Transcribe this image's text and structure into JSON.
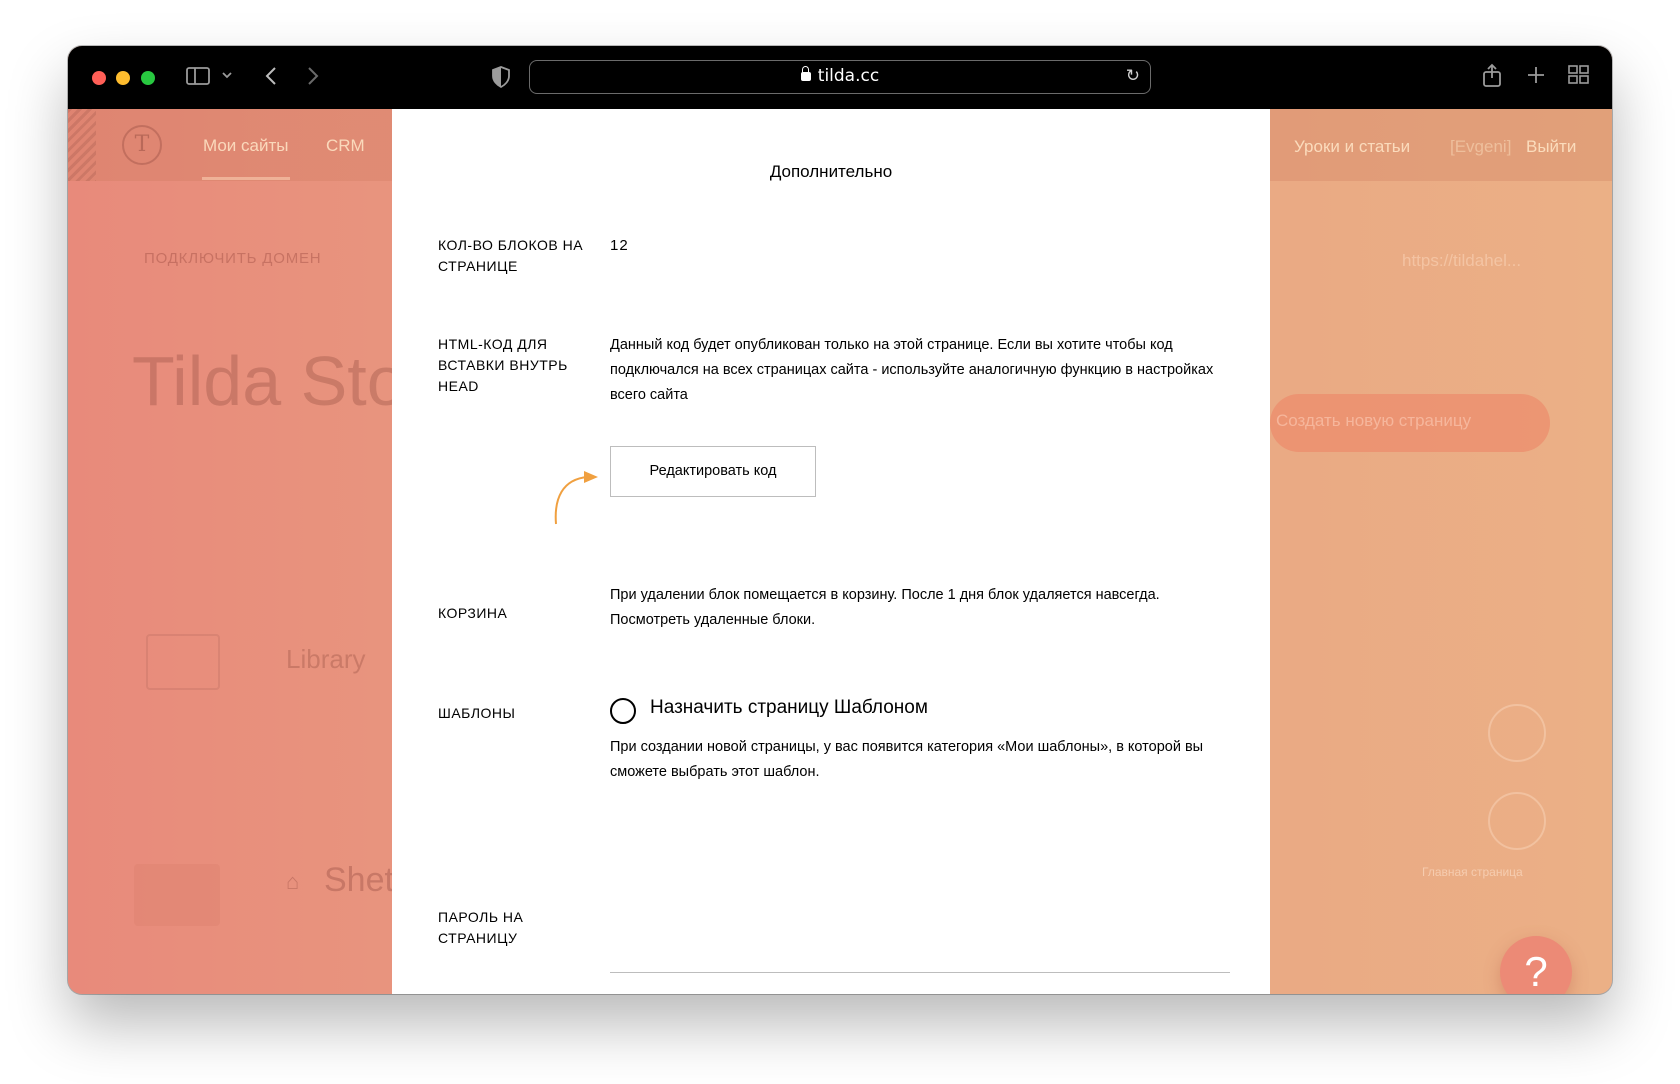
{
  "browser": {
    "url": "tilda.cc"
  },
  "background_site": {
    "nav": {
      "my_sites": "Мои сайты",
      "crm": "CRM",
      "lessons": "Уроки и статьи",
      "user": "[Evgeni]",
      "logout": "Выйти"
    },
    "connect_domain": "ПОДКЛЮЧИТЬ ДОМЕН",
    "site_title": "Tilda Sto",
    "url_preview": "https://tildahel...",
    "create_page": "Создать новую страницу",
    "library": "Library",
    "shet": "Shet",
    "main_page": "Главная страница",
    "help": "?"
  },
  "panel": {
    "title": "Дополнительно",
    "blocks": {
      "label": "КОЛ-ВО БЛОКОВ НА СТРАНИЦЕ",
      "value": "12"
    },
    "head_code": {
      "label": "HTML-КОД ДЛЯ ВСТАВКИ ВНУТРЬ HEAD",
      "description": "Данный код будет опубликован только на этой странице. Если вы хотите чтобы код подключался на всех страницах сайта - используйте аналогичную функцию в настройках всего сайта",
      "button": "Редактировать код"
    },
    "trash": {
      "label": "КОРЗИНА",
      "description": "При удалении блок помещается в корзину. После 1 дня блок удаляется навсегда.",
      "link": "Посмотреть удаленные блоки."
    },
    "templates": {
      "label": "ШАБЛОНЫ",
      "checkbox_label": "Назначить страницу Шаблоном",
      "description": "При создании новой страницы, у вас появится категория «Мои шаблоны», в которой вы сможете выбрать этот шаблон."
    },
    "password": {
      "label": "ПАРОЛЬ НА СТРАНИЦУ",
      "value": ""
    }
  },
  "colors": {
    "accent_arrow": "#f0a040",
    "help_button": "#ec8a76"
  }
}
